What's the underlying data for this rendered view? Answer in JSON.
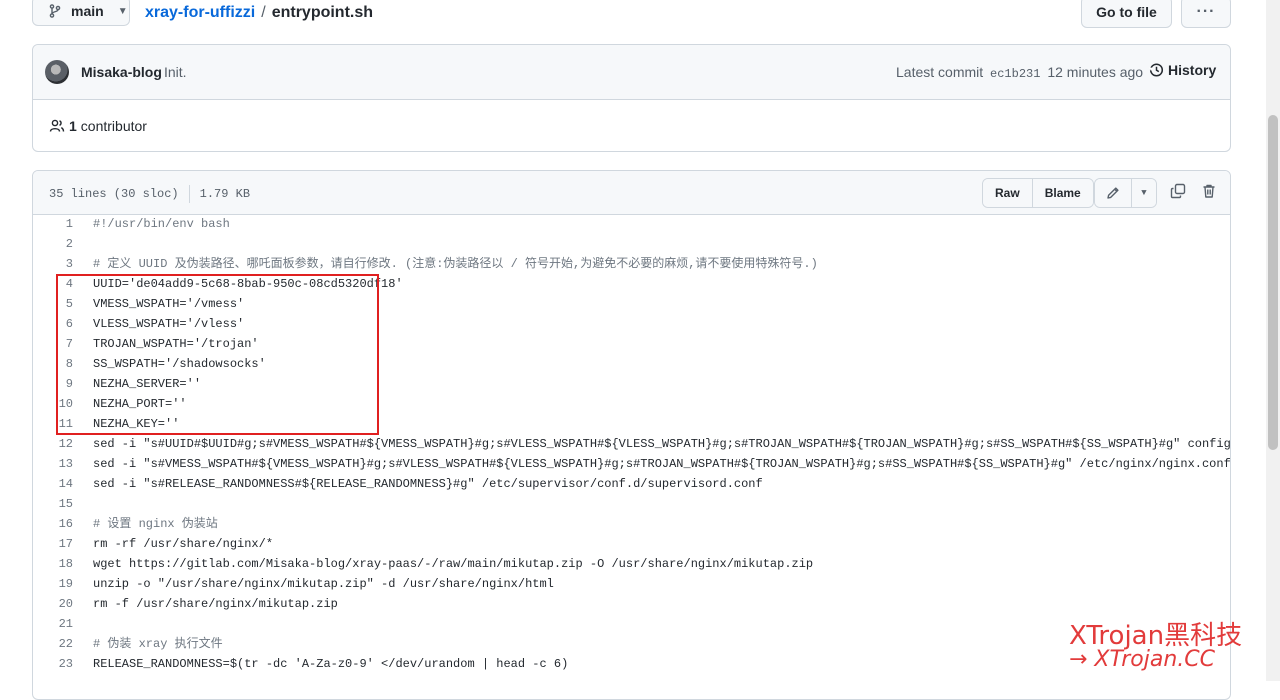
{
  "header": {
    "branch": "main",
    "repo": "xray-for-uffizzi",
    "separator": "/",
    "file": "entrypoint.sh",
    "goto_label": "Go to file",
    "more_label": "···"
  },
  "commit": {
    "author": "Misaka-blog",
    "message": "Init.",
    "latest_label": "Latest commit",
    "sha": "ec1b231",
    "time": "12 minutes ago",
    "history_label": "History",
    "contributors_count": "1",
    "contributors_label": "contributor"
  },
  "file": {
    "lines_info": "35 lines (30 sloc)",
    "size": "1.79 KB",
    "raw_label": "Raw",
    "blame_label": "Blame"
  },
  "code_lines": [
    {
      "n": "1",
      "t": "#!/usr/bin/env bash"
    },
    {
      "n": "2",
      "t": ""
    },
    {
      "n": "3",
      "t": "# 定义 UUID 及伪装路径、哪吒面板参数，请自行修改. (注意:伪装路径以 / 符号开始,为避免不必要的麻烦,请不要使用特殊符号.)"
    },
    {
      "n": "4",
      "t": "UUID='de04add9-5c68-8bab-950c-08cd5320df18'"
    },
    {
      "n": "5",
      "t": "VMESS_WSPATH='/vmess'"
    },
    {
      "n": "6",
      "t": "VLESS_WSPATH='/vless'"
    },
    {
      "n": "7",
      "t": "TROJAN_WSPATH='/trojan'"
    },
    {
      "n": "8",
      "t": "SS_WSPATH='/shadowsocks'"
    },
    {
      "n": "9",
      "t": "NEZHA_SERVER=''"
    },
    {
      "n": "10",
      "t": "NEZHA_PORT=''"
    },
    {
      "n": "11",
      "t": "NEZHA_KEY=''"
    },
    {
      "n": "12",
      "t": "sed -i \"s#UUID#$UUID#g;s#VMESS_WSPATH#${VMESS_WSPATH}#g;s#VLESS_WSPATH#${VLESS_WSPATH}#g;s#TROJAN_WSPATH#${TROJAN_WSPATH}#g;s#SS_WSPATH#${SS_WSPATH}#g\" config.json"
    },
    {
      "n": "13",
      "t": "sed -i \"s#VMESS_WSPATH#${VMESS_WSPATH}#g;s#VLESS_WSPATH#${VLESS_WSPATH}#g;s#TROJAN_WSPATH#${TROJAN_WSPATH}#g;s#SS_WSPATH#${SS_WSPATH}#g\" /etc/nginx/nginx.conf"
    },
    {
      "n": "14",
      "t": "sed -i \"s#RELEASE_RANDOMNESS#${RELEASE_RANDOMNESS}#g\" /etc/supervisor/conf.d/supervisord.conf"
    },
    {
      "n": "15",
      "t": ""
    },
    {
      "n": "16",
      "t": "# 设置 nginx 伪装站"
    },
    {
      "n": "17",
      "t": "rm -rf /usr/share/nginx/*"
    },
    {
      "n": "18",
      "t": "wget https://gitlab.com/Misaka-blog/xray-paas/-/raw/main/mikutap.zip -O /usr/share/nginx/mikutap.zip"
    },
    {
      "n": "19",
      "t": "unzip -o \"/usr/share/nginx/mikutap.zip\" -d /usr/share/nginx/html"
    },
    {
      "n": "20",
      "t": "rm -f /usr/share/nginx/mikutap.zip"
    },
    {
      "n": "21",
      "t": ""
    },
    {
      "n": "22",
      "t": "# 伪装 xray 执行文件"
    },
    {
      "n": "23",
      "t": "RELEASE_RANDOMNESS=$(tr -dc 'A-Za-z0-9' </dev/urandom | head -c 6)"
    }
  ],
  "watermark": {
    "line1": "XTrojan黑科技",
    "line2": "→ XTrojan.CC"
  },
  "colors": {
    "link": "#0969da",
    "highlight_border": "#e02020",
    "watermark": "#e23b3b"
  }
}
